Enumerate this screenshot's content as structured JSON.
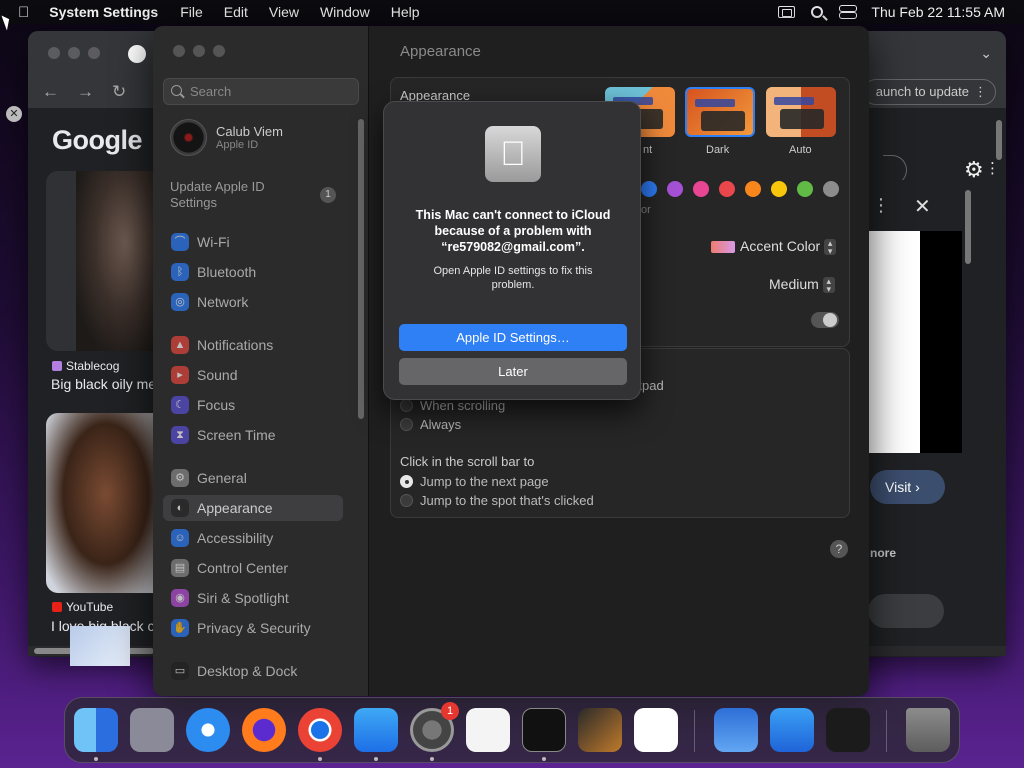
{
  "menubar": {
    "app_name": "System Settings",
    "menus": [
      "File",
      "Edit",
      "View",
      "Window",
      "Help"
    ],
    "clock": "Thu Feb 22  11:55 AM"
  },
  "browser": {
    "update_label": "aunch to update",
    "google_logo": "Google",
    "results": [
      {
        "source": "Stablecog",
        "caption": "Big black oily me"
      },
      {
        "source": "YouTube",
        "caption": "I love big black c"
      }
    ],
    "visit_label": "Visit ›",
    "more_label": "nore"
  },
  "sidebar": {
    "search_placeholder": "Search",
    "user_name": "Calub Viem",
    "user_sub": "Apple ID",
    "update_line1": "Update Apple ID",
    "update_line2": "Settings",
    "update_badge": "1",
    "items": [
      {
        "label": "Wi-Fi",
        "color": "#2b7cf6",
        "glyph": "⌒"
      },
      {
        "label": "Bluetooth",
        "color": "#2b7cf6",
        "glyph": "ᛒ"
      },
      {
        "label": "Network",
        "color": "#2b7cf6",
        "glyph": "◎"
      },
      {
        "label": "Notifications",
        "color": "#e5463c",
        "glyph": "▲"
      },
      {
        "label": "Sound",
        "color": "#e5463c",
        "glyph": "▸"
      },
      {
        "label": "Focus",
        "color": "#5a4fd6",
        "glyph": "☾"
      },
      {
        "label": "Screen Time",
        "color": "#5a4fd6",
        "glyph": "⧗"
      },
      {
        "label": "General",
        "color": "#8a8a8a",
        "glyph": "⚙"
      },
      {
        "label": "Appearance",
        "color": "#222222",
        "glyph": "◐"
      },
      {
        "label": "Accessibility",
        "color": "#2b7cf6",
        "glyph": "☺"
      },
      {
        "label": "Control Center",
        "color": "#8a8a8a",
        "glyph": "▤"
      },
      {
        "label": "Siri & Spotlight",
        "color": "#b64fd6",
        "glyph": "◉"
      },
      {
        "label": "Privacy & Security",
        "color": "#2b7cf6",
        "glyph": "✋"
      },
      {
        "label": "Desktop & Dock",
        "color": "#222222",
        "glyph": "▭"
      }
    ]
  },
  "main": {
    "title": "Appearance",
    "appearance_label": "Appearance",
    "theme_light_partial": "nt",
    "theme_dark": "Dark",
    "theme_auto": "Auto",
    "highlight_partial": "or",
    "accent_label": "Accent Color",
    "sidebar_size": "Medium",
    "trackpad_partial": "ckpad",
    "scroll_options": [
      "When scrolling",
      "Always"
    ],
    "click_label": "Click in the scroll bar to",
    "click_options": [
      "Jump to the next page",
      "Jump to the spot that's clicked"
    ],
    "help": "?",
    "accent_colors": [
      "#2e7cf6",
      "#a551d5",
      "#e84694",
      "#e9474b",
      "#f7861d",
      "#f8c60b",
      "#62ba46",
      "#8c8c8c"
    ]
  },
  "dialog": {
    "title": "This Mac can't connect to iCloud because of a problem with “re579082@gmail.com”.",
    "message": "Open Apple ID settings to fix this problem.",
    "primary": "Apple ID Settings…",
    "secondary": "Later"
  },
  "dock": {
    "system_settings_badge": "1",
    "apps": [
      "Finder",
      "Launchpad",
      "Safari",
      "Firefox",
      "Chrome",
      "App Store",
      "System Settings",
      "TextEdit",
      "Terminal",
      "GarageBand",
      "VS Code",
      "Weather",
      "Keynote",
      "Bing",
      "Trash"
    ]
  }
}
